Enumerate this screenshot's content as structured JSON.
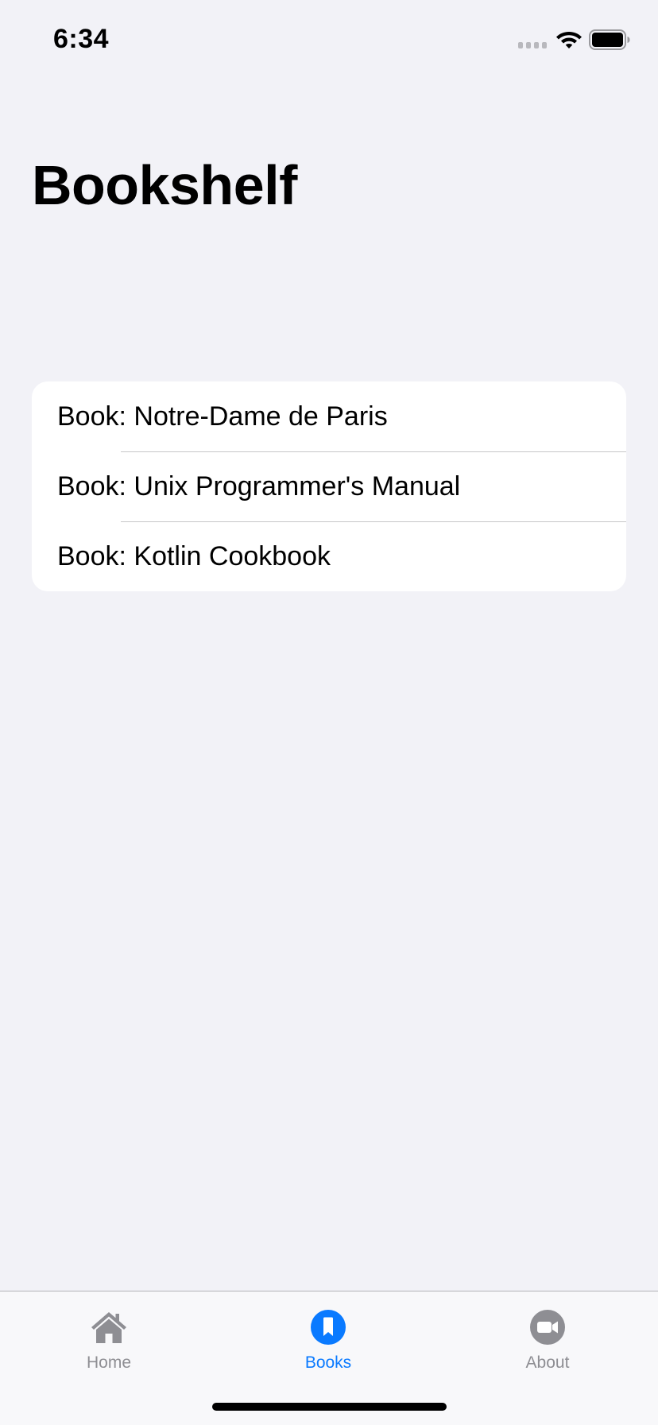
{
  "status_bar": {
    "time": "6:34",
    "icons": [
      "cellular-signal-icon",
      "wifi-icon",
      "battery-icon"
    ]
  },
  "header": {
    "title": "Bookshelf"
  },
  "books": {
    "items": [
      {
        "label": "Book: Notre-Dame de Paris"
      },
      {
        "label": "Book: Unix Programmer's Manual"
      },
      {
        "label": "Book: Kotlin Cookbook"
      }
    ]
  },
  "tab_bar": {
    "active_tab": "Books",
    "tabs": [
      {
        "label": "Home",
        "icon": "house-icon"
      },
      {
        "label": "Books",
        "icon": "bookmark-circle-icon"
      },
      {
        "label": "About",
        "icon": "video-camera-circle-icon"
      }
    ]
  },
  "colors": {
    "background": "#f2f2f7",
    "accent": "#0a7aff",
    "inactive_tab": "#8e8e93",
    "card": "#ffffff"
  }
}
